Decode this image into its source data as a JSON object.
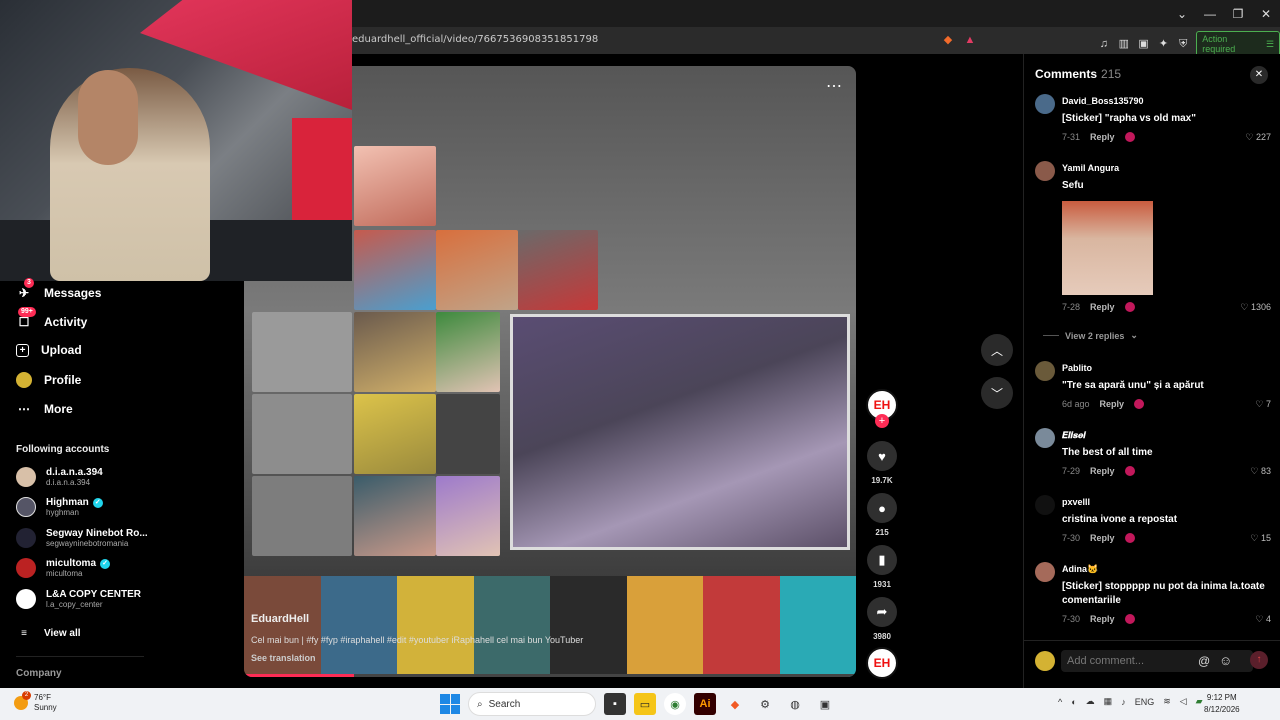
{
  "browser": {
    "url": "eduardhell_official/video/7667536908351851798",
    "action_required": "Action required"
  },
  "sidebar": {
    "items": [
      {
        "label": "Messages",
        "icon": "messages-icon",
        "badge": "3"
      },
      {
        "label": "Activity",
        "icon": "activity-icon",
        "badge": "99+"
      },
      {
        "label": "Upload",
        "icon": "upload-icon"
      },
      {
        "label": "Profile",
        "icon": "profile-icon"
      },
      {
        "label": "More",
        "icon": "more-icon"
      }
    ],
    "following_title": "Following accounts",
    "accounts": [
      {
        "name": "d.i.a.n.a.394",
        "handle": "d.i.a.n.a.394",
        "verified": false
      },
      {
        "name": "Highman",
        "handle": "hyghman",
        "verified": true
      },
      {
        "name": "Segway Ninebot Ro...",
        "handle": "segwayninebotromania",
        "verified": false
      },
      {
        "name": "micultoma",
        "handle": "micultoma",
        "verified": true
      },
      {
        "name": "L&A COPY CENTER",
        "handle": "l.a_copy_center",
        "verified": false
      }
    ],
    "view_all": "View all",
    "company": "Company"
  },
  "video": {
    "author": "EduardHell",
    "description": "Cel mai bun | #fy #fyp #iraphahell #edit #youtuber iRaphahell cel mai bun YouTuber",
    "see_translation": "See translation",
    "progress": 0.18
  },
  "actions": {
    "likes": "19.7K",
    "comments": "215",
    "saves": "1931",
    "shares": "3980",
    "author_initials": "EH"
  },
  "comments": {
    "title": "Comments",
    "count": "215",
    "list": [
      {
        "user": "David_Boss135790",
        "text": "[Sticker] \"rapha vs old max\"",
        "date": "7-31",
        "likes": "227"
      },
      {
        "user": "Yamil Angura",
        "text": "Sefu",
        "date": "7-28",
        "likes": "1306",
        "has_sticker": true
      },
      {
        "user": "Pablito",
        "text": "\"Tre sa apară unu\" și a apărut",
        "date": "6d ago",
        "likes": "7"
      },
      {
        "user": "𝑬𝒍𝒊𝒔𝒆𝒊",
        "text": "The best of all time",
        "date": "7-29",
        "likes": "83"
      },
      {
        "user": "pxvelll",
        "text": "cristina ivone a repostat",
        "date": "7-30",
        "likes": "15"
      },
      {
        "user": "Adina🐱",
        "text": "[Sticker] stoppppp nu pot da inima la.toate comentariile",
        "date": "7-30",
        "likes": "4"
      }
    ],
    "reply_label": "Reply",
    "view_replies": "View 2 replies",
    "add_placeholder": "Add comment..."
  },
  "taskbar": {
    "temperature": "76°F",
    "condition": "Sunny",
    "weather_badge": "2",
    "search": "Search",
    "lang": "ENG",
    "time": "9:12 PM",
    "date": "8/12/2026"
  }
}
